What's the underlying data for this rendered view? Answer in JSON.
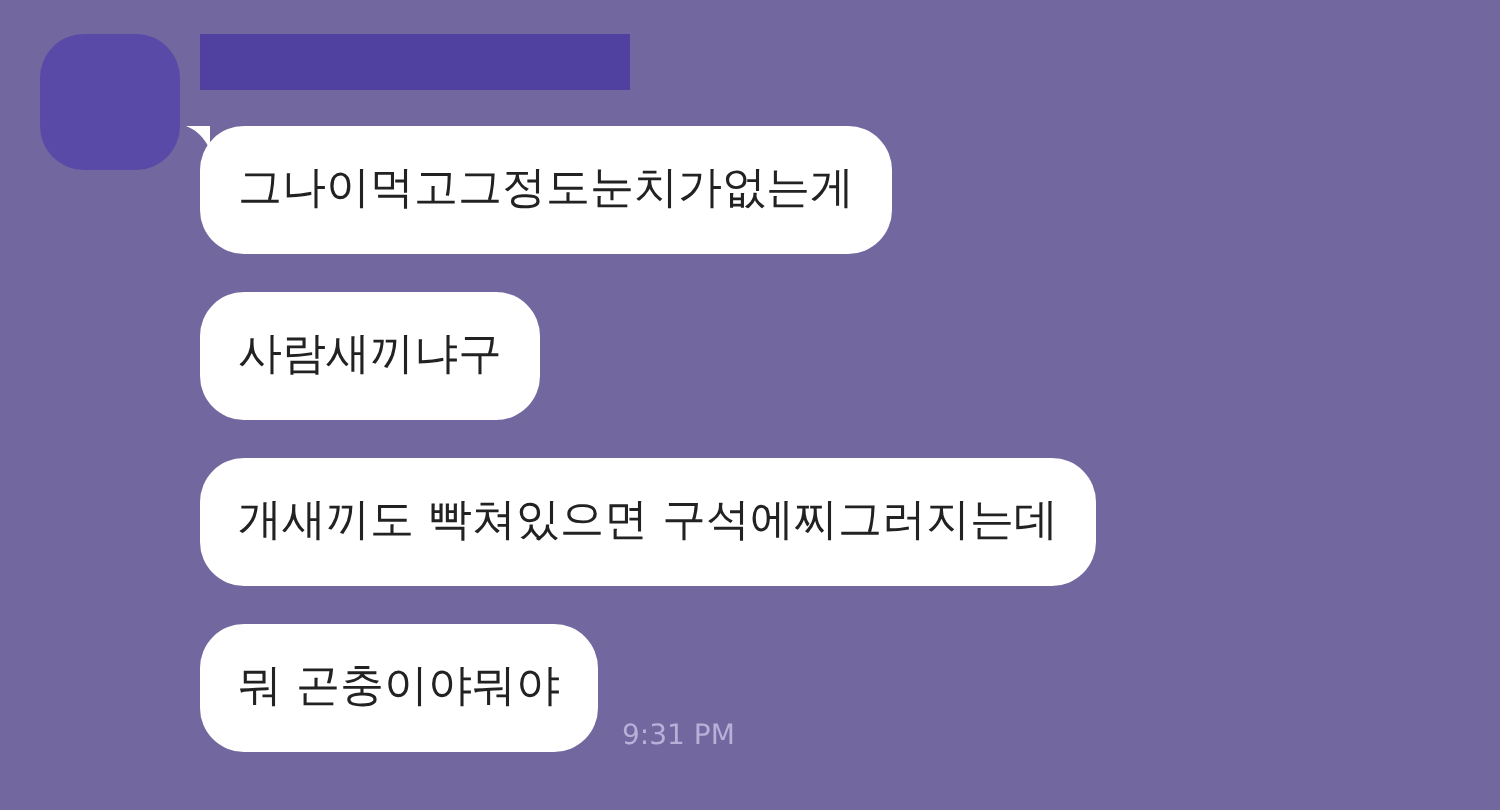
{
  "messages": [
    {
      "text": "그나이먹고그정도눈치가없는게"
    },
    {
      "text": "사람새끼냐구"
    },
    {
      "text": "개새끼도 빡쳐있으면 구석에찌그러지는데"
    },
    {
      "text": "뭐 곤충이야뭐야"
    }
  ],
  "time": "9:31 PM"
}
